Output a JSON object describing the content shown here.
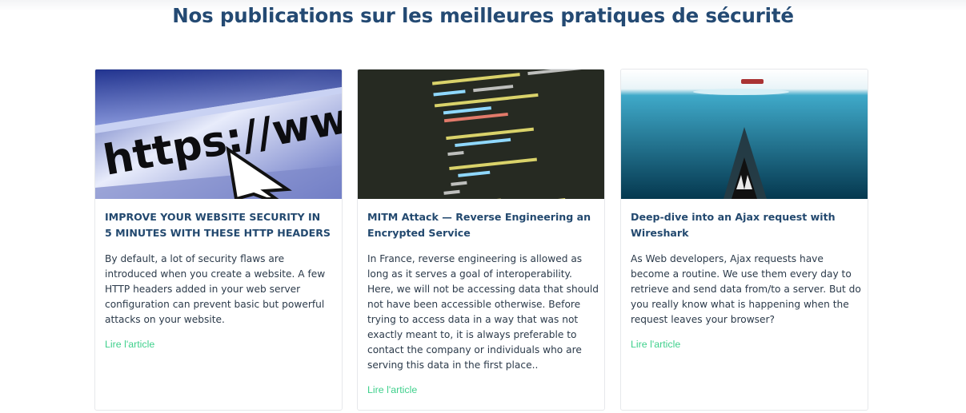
{
  "page": {
    "title": "Nos publications sur les meilleures pratiques de sécurité"
  },
  "cards": [
    {
      "image_icon": "https-url-cursor-image",
      "image_text": "https://www",
      "title_line1": "IMPROVE YOUR WEBSITE SECURITY IN",
      "title_line2": "5 MINUTES WITH THESE HTTP HEADERS",
      "excerpt": "By default, a lot of security flaws are introduced when you create a website. A few HTTP headers added in your web server configuration can prevent basic but powerful attacks on your website.",
      "link_label": "Lire l'article"
    },
    {
      "image_icon": "code-screen-image",
      "title_line1": "MITM Attack — Reverse Engineering an",
      "title_line2": "Encrypted Service",
      "excerpt": "In France, reverse engineering is allowed as long as it serves a goal of interoperability. Here, we will not be accessing data that should not have been accessible otherwise. Before trying to access data in a way that was not exactly meant to, it is always preferable to contact the company or individuals who are serving this data in the first place..",
      "link_label": "Lire l'article"
    },
    {
      "image_icon": "shark-underwater-image",
      "title_line1": "Deep-dive into an Ajax request with",
      "title_line2": "Wireshark",
      "excerpt": "As Web developers, Ajax requests have become a routine. We use them every day to retrieve and send data from/to a server. But do you really know what is happening when the request leaves your browser?",
      "link_label": "Lire l'article"
    }
  ],
  "colors": {
    "title": "#244a73",
    "card_title": "#23496f",
    "text": "#2b3a4a",
    "link": "#3fd08c",
    "card_border": "#e6e8eb"
  }
}
